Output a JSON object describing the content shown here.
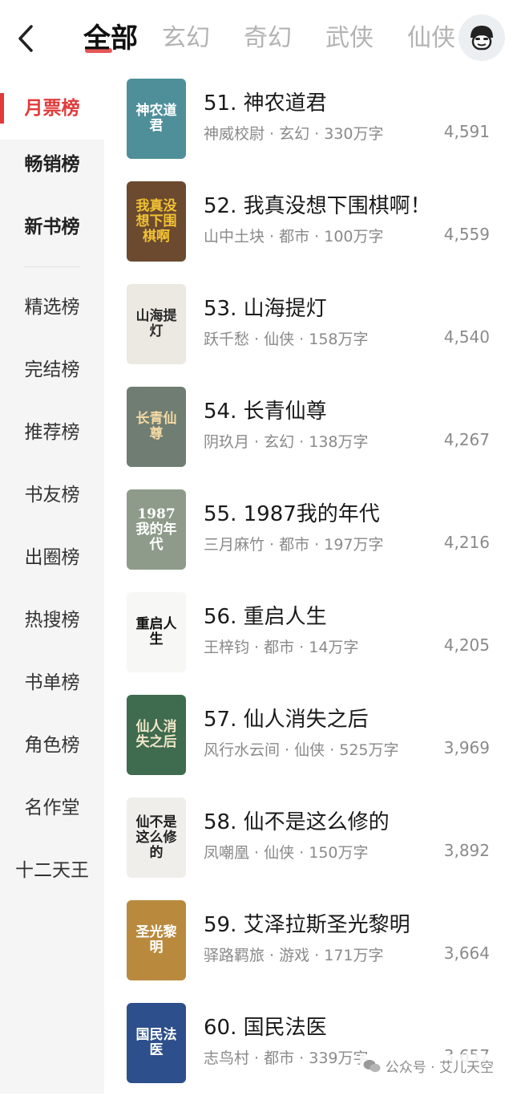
{
  "tabs": [
    "全部",
    "玄幻",
    "奇幻",
    "武侠",
    "仙侠"
  ],
  "sidebar": {
    "items": [
      "月票榜",
      "畅销榜",
      "新书榜",
      "精选榜",
      "完结榜",
      "推荐榜",
      "书友榜",
      "出圈榜",
      "热搜榜",
      "书单榜",
      "角色榜",
      "名作堂",
      "十二天王"
    ]
  },
  "books": [
    {
      "title": "51. 神农道君",
      "meta": "神威校尉 · 玄幻 · 330万字",
      "score": "4,591",
      "cover_text": "神农道君",
      "cover_bg": "#4f8f9a",
      "cover_fg": "#ffffff"
    },
    {
      "title": "52. 我真没想下围棋啊！",
      "meta": "山中土块 · 都市 · 100万字",
      "score": "4,559",
      "cover_text": "我真没想下围棋啊",
      "cover_bg": "#6b4a2f",
      "cover_fg": "#f1c232"
    },
    {
      "title": "53. 山海提灯",
      "meta": "跃千愁 · 仙侠 · 158万字",
      "score": "4,540",
      "cover_text": "山海提灯",
      "cover_bg": "#ece8e2",
      "cover_fg": "#2b2b2b"
    },
    {
      "title": "54. 长青仙尊",
      "meta": "阴玖月 · 玄幻 · 138万字",
      "score": "4,267",
      "cover_text": "长青仙尊",
      "cover_bg": "#6f7d72",
      "cover_fg": "#f3d9a4"
    },
    {
      "title": "55. 1987我的年代",
      "meta": "三月麻竹 · 都市 · 197万字",
      "score": "4,216",
      "cover_text": "1987 我的年代",
      "cover_bg": "#8f9b8a",
      "cover_fg": "#ffffff"
    },
    {
      "title": "56. 重启人生",
      "meta": "王梓钧 · 都市 · 14万字",
      "score": "4,205",
      "cover_text": "重启人生",
      "cover_bg": "#f7f7f5",
      "cover_fg": "#111111"
    },
    {
      "title": "57. 仙人消失之后",
      "meta": "风行水云间 · 仙侠 · 525万字",
      "score": "3,969",
      "cover_text": "仙人消失之后",
      "cover_bg": "#3f6b4f",
      "cover_fg": "#f0e6c8"
    },
    {
      "title": "58. 仙不是这么修的",
      "meta": "凤嘲凰 · 仙侠 · 150万字",
      "score": "3,892",
      "cover_text": "仙不是这么修的",
      "cover_bg": "#efeeea",
      "cover_fg": "#222222"
    },
    {
      "title": "59. 艾泽拉斯圣光黎明",
      "meta": "驿路羁旅 · 游戏 · 171万字",
      "score": "3,664",
      "cover_text": "圣光黎明",
      "cover_bg": "#b98a3e",
      "cover_fg": "#ffffff"
    },
    {
      "title": "60. 国民法医",
      "meta": "志鸟村 · 都市 · 339万字",
      "score": "3,657",
      "cover_text": "国民法医",
      "cover_bg": "#2d4f8c",
      "cover_fg": "#ffffff"
    }
  ],
  "watermark": "公众号 · 艾儿天空",
  "colors": {
    "accent": "#e23a3a",
    "sidebar_bg": "#f5f5f5"
  }
}
